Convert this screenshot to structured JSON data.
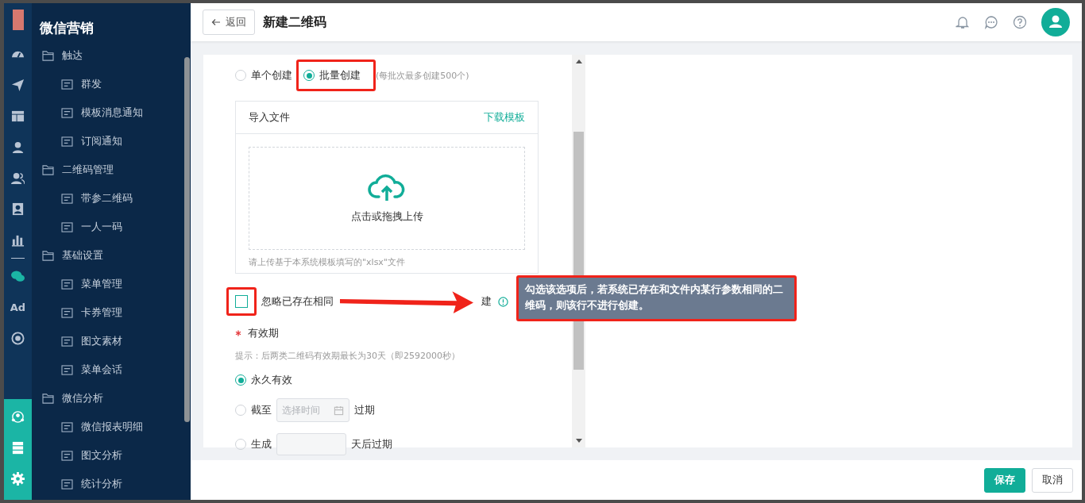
{
  "sidebar": {
    "title": "微信营销",
    "groups": [
      {
        "label": "触达",
        "children": [
          {
            "label": "群发"
          },
          {
            "label": "模板消息通知"
          },
          {
            "label": "订阅通知"
          }
        ]
      },
      {
        "label": "二维码管理",
        "children": [
          {
            "label": "带参二维码"
          },
          {
            "label": "一人一码"
          }
        ]
      },
      {
        "label": "基础设置",
        "children": [
          {
            "label": "菜单管理"
          },
          {
            "label": "卡券管理"
          },
          {
            "label": "图文素材"
          },
          {
            "label": "菜单会话"
          }
        ]
      },
      {
        "label": "微信分析",
        "children": [
          {
            "label": "微信报表明细"
          },
          {
            "label": "图文分析"
          },
          {
            "label": "统计分析"
          }
        ]
      }
    ]
  },
  "rail": {
    "ad_label": "Ad"
  },
  "header": {
    "back_button": "返回",
    "title": "新建二维码"
  },
  "create_modes": [
    {
      "label": "单个创建",
      "selected": false
    },
    {
      "label": "批量创建",
      "selected": true,
      "highlighted": true,
      "hint": "(每批次最多创建500个)"
    }
  ],
  "import": {
    "title": "导入文件",
    "download_link": "下载模板",
    "upload_text": "点击或拖拽上传",
    "note": "请上传基于本系统模板填写的\"xlsx\"文件"
  },
  "ignore_option": {
    "checked": false,
    "highlighted": true,
    "label_parts": [
      "忽略已存在相同",
      "建"
    ]
  },
  "validity": {
    "label": "有效期",
    "required": true,
    "hint": "提示：后两类二维码有效期最长为30天（即2592000秒）",
    "options": [
      {
        "kind": "plain",
        "label": "永久有效",
        "selected": true
      },
      {
        "kind": "date",
        "label": "截至",
        "placeholder": "选择时间",
        "suffix": "过期",
        "selected": false
      },
      {
        "kind": "days",
        "label": "生成",
        "suffix": "天后过期",
        "selected": false
      }
    ]
  },
  "annotation": {
    "callout": "勾选该选项后，若系统已存在和文件内某行参数相同的二维码，则该行不进行创建。"
  },
  "footer": {
    "buttons": [
      {
        "label": "保存",
        "kind": "primary"
      },
      {
        "label": "取消",
        "kind": "default"
      }
    ]
  }
}
